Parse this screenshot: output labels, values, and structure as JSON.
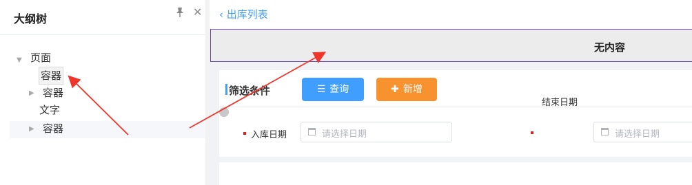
{
  "left_panel": {
    "title": "大纲树",
    "tree": [
      {
        "label": "页面"
      },
      {
        "label": "容器"
      },
      {
        "label": "容器"
      },
      {
        "label": "文字"
      },
      {
        "label": "容器"
      }
    ]
  },
  "header": {
    "back_label": "出库列表"
  },
  "placeholder_block": {
    "text": "无内容"
  },
  "filter": {
    "title": "筛选条件",
    "query_label": "查询",
    "add_label": "新增",
    "end_date_label": "结束日期",
    "start_date_label": "入库日期",
    "date_placeholder": "请选择日期"
  }
}
